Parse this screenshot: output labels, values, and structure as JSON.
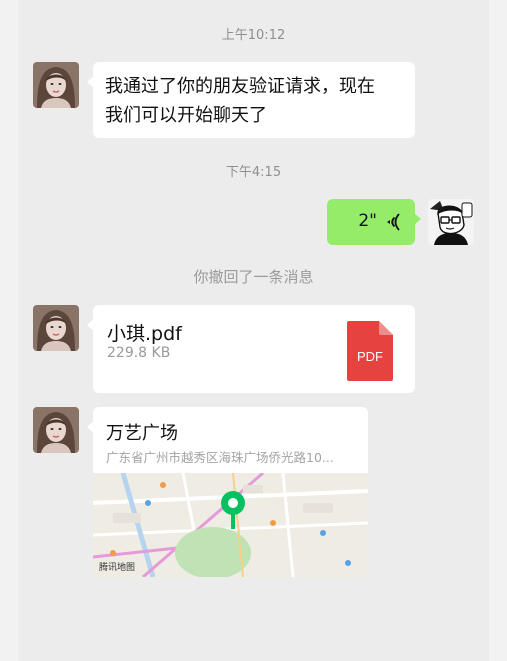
{
  "chat": {
    "timestamps": {
      "first": "上午10:12",
      "second": "下午4:15"
    },
    "system_message": "你撤回了一条消息",
    "friend_message": {
      "line1": "我通过了你的朋友验证请求，现在",
      "line2": "我们可以开始聊天了"
    },
    "voice_message": {
      "duration": "2\""
    },
    "file_message": {
      "name": "小琪.pdf",
      "size": "229.8 KB",
      "icon_label": "PDF"
    },
    "location_message": {
      "title": "万艺广场",
      "address": "广东省广州市越秀区海珠广场侨光路10...",
      "map_brand": "腾讯地图"
    }
  },
  "colors": {
    "background": "#ececec",
    "bubble_white": "#ffffff",
    "bubble_green": "#95ec69",
    "pdf_red": "#e64340",
    "map_pin": "#07c160"
  }
}
